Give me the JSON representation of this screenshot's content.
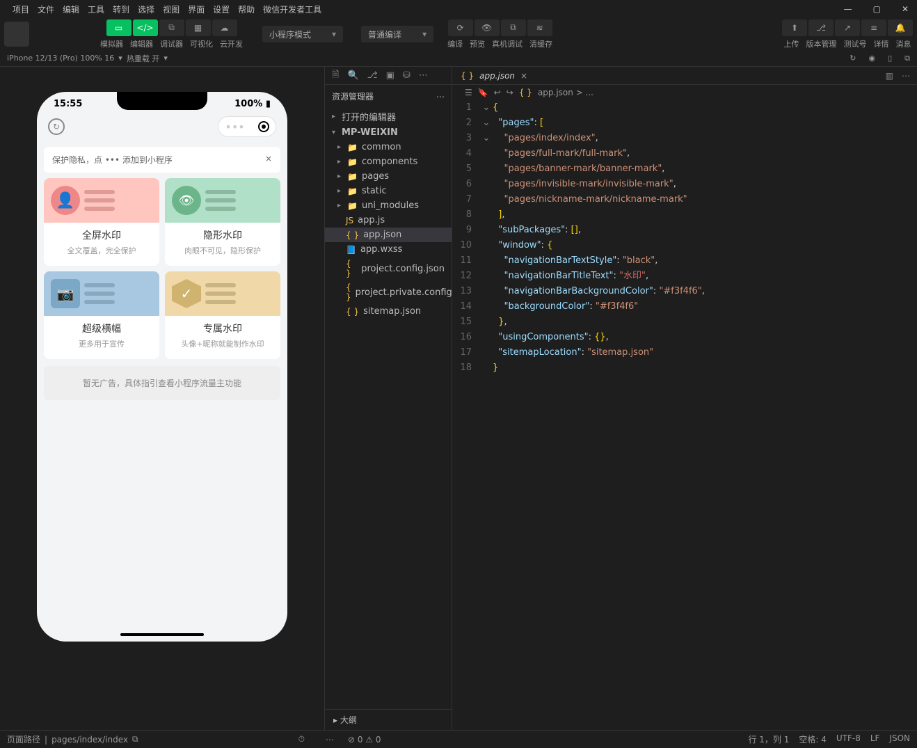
{
  "menu": [
    "项目",
    "文件",
    "编辑",
    "工具",
    "转到",
    "选择",
    "视图",
    "界面",
    "设置",
    "帮助",
    "微信开发者工具"
  ],
  "toolbar": {
    "labels": [
      "模拟器",
      "编辑器",
      "调试器",
      "可视化",
      "云开发"
    ],
    "sel1": "小程序模式",
    "sel2": "普通编译",
    "mid": [
      "编译",
      "预览",
      "真机调试",
      "清缓存"
    ],
    "right": [
      "上传",
      "版本管理",
      "测试号",
      "详情",
      "消息"
    ]
  },
  "sim": {
    "device": "iPhone 12/13 (Pro) 100% 16",
    "hot": "热重载 开"
  },
  "phone": {
    "time": "15:55",
    "battery": "100%",
    "tip": "保护隐私，点 ••• 添加到小程序",
    "cards": [
      {
        "t": "全屏水印",
        "s": "全文覆盖，完全保护"
      },
      {
        "t": "隐形水印",
        "s": "肉眼不可见，隐形保护"
      },
      {
        "t": "超级横幅",
        "s": "更多用于宣传"
      },
      {
        "t": "专属水印",
        "s": "头像+昵称就能制作水印"
      }
    ],
    "ad": "暂无广告，具体指引查看小程序流量主功能"
  },
  "explorer": {
    "title": "资源管理器",
    "open": "打开的编辑器",
    "root": "MP-WEIXIN",
    "items": [
      "common",
      "components",
      "pages",
      "static",
      "uni_modules",
      "app.js",
      "app.json",
      "app.wxss",
      "project.config.json",
      "project.private.config.js...",
      "sitemap.json"
    ],
    "outline": "大纲"
  },
  "editor": {
    "tab": "app.json",
    "crumb": "app.json > ..."
  },
  "code": {
    "lines": [
      [
        {
          "t": "{",
          "c": "brace"
        }
      ],
      [
        {
          "t": "  \"pages\"",
          "c": "key"
        },
        {
          "t": ": ",
          "c": "punc"
        },
        {
          "t": "[",
          "c": "brace"
        }
      ],
      [
        {
          "t": "    \"pages/index/index\"",
          "c": "str"
        },
        {
          "t": ",",
          "c": "punc"
        }
      ],
      [
        {
          "t": "    \"pages/full-mark/full-mark\"",
          "c": "str"
        },
        {
          "t": ",",
          "c": "punc"
        }
      ],
      [
        {
          "t": "    \"pages/banner-mark/banner-mark\"",
          "c": "str"
        },
        {
          "t": ",",
          "c": "punc"
        }
      ],
      [
        {
          "t": "    \"pages/invisible-mark/invisible-mark\"",
          "c": "str"
        },
        {
          "t": ",",
          "c": "punc"
        }
      ],
      [
        {
          "t": "    \"pages/nickname-mark/nickname-mark\"",
          "c": "str"
        }
      ],
      [
        {
          "t": "  ]",
          "c": "brace"
        },
        {
          "t": ",",
          "c": "punc"
        }
      ],
      [
        {
          "t": "  \"subPackages\"",
          "c": "key"
        },
        {
          "t": ": ",
          "c": "punc"
        },
        {
          "t": "[]",
          "c": "brace"
        },
        {
          "t": ",",
          "c": "punc"
        }
      ],
      [
        {
          "t": "  \"window\"",
          "c": "key"
        },
        {
          "t": ": ",
          "c": "punc"
        },
        {
          "t": "{",
          "c": "brace"
        }
      ],
      [
        {
          "t": "    \"navigationBarTextStyle\"",
          "c": "key"
        },
        {
          "t": ": ",
          "c": "punc"
        },
        {
          "t": "\"black\"",
          "c": "str"
        },
        {
          "t": ",",
          "c": "punc"
        }
      ],
      [
        {
          "t": "    \"navigationBarTitleText\"",
          "c": "key"
        },
        {
          "t": ": ",
          "c": "punc"
        },
        {
          "t": "\"水印\"",
          "c": "cn"
        },
        {
          "t": ",",
          "c": "punc"
        }
      ],
      [
        {
          "t": "    \"navigationBarBackgroundColor\"",
          "c": "key"
        },
        {
          "t": ": ",
          "c": "punc"
        },
        {
          "t": "\"#f3f4f6\"",
          "c": "str"
        },
        {
          "t": ",",
          "c": "punc"
        }
      ],
      [
        {
          "t": "    \"backgroundColor\"",
          "c": "key"
        },
        {
          "t": ": ",
          "c": "punc"
        },
        {
          "t": "\"#f3f4f6\"",
          "c": "str"
        }
      ],
      [
        {
          "t": "  }",
          "c": "brace"
        },
        {
          "t": ",",
          "c": "punc"
        }
      ],
      [
        {
          "t": "  \"usingComponents\"",
          "c": "key"
        },
        {
          "t": ": ",
          "c": "punc"
        },
        {
          "t": "{}",
          "c": "brace"
        },
        {
          "t": ",",
          "c": "punc"
        }
      ],
      [
        {
          "t": "  \"sitemapLocation\"",
          "c": "key"
        },
        {
          "t": ": ",
          "c": "punc"
        },
        {
          "t": "\"sitemap.json\"",
          "c": "str"
        }
      ],
      [
        {
          "t": "}",
          "c": "brace"
        }
      ]
    ]
  },
  "status": {
    "left": "页面路径",
    "path": "pages/index/index",
    "warn": "⊘ 0 ⚠ 0",
    "right": [
      "行 1，列 1",
      "空格: 4",
      "UTF-8",
      "LF",
      "JSON"
    ]
  }
}
